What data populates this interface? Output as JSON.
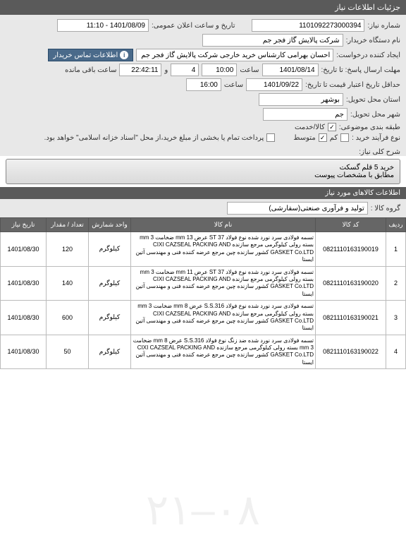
{
  "header": {
    "title": "جزئیات اطلاعات نیاز"
  },
  "form": {
    "reqno_lbl": "شماره نیاز:",
    "reqno": "1101092273000394",
    "pubdate_lbl": "تاریخ و ساعت اعلان عمومی:",
    "pubdate": "1401/08/09 - 11:10",
    "buyer_lbl": "نام دستگاه خریدار:",
    "buyer": "شرکت پالایش گاز فجر جم",
    "creator_lbl": "ایجاد کننده درخواست:",
    "creator": "احسان بهرامی کارشناس خرید خارجی شرکت پالایش گاز فجر جم",
    "contact_btn": "اطلاعات تماس خریدار",
    "deadline_lbl": "مهلت ارسال پاسخ: تا تاریخ:",
    "deadline_date": "1401/08/14",
    "time_lbl": "ساعت",
    "deadline_time": "10:00",
    "remain": "4",
    "remain_suffix": "و",
    "remain_time": "22:42:11",
    "remain_txt": "ساعت باقی مانده",
    "validity_lbl": "حداقل تاریخ اعتبار قیمت تا تاریخ:",
    "validity_date": "1401/09/22",
    "validity_time": "16:00",
    "province_lbl": "استان محل تحویل:",
    "province": "بوشهر",
    "city_lbl": "شهر محل تحویل:",
    "city": "جم",
    "service_lbl": "طبقه بندی موضوعی:",
    "service_opt": "کالا/خدمت",
    "process_lbl": "نوع فرآیند خرید :",
    "process_low": "کم",
    "process_mid": "متوسط",
    "process_note": "پرداخت تمام یا بخشی از مبلغ خرید،از محل \"اسناد خزانه اسلامی\" خواهد بود."
  },
  "desc": {
    "title_lbl": "شرح کلی نیاز:",
    "line1": "خرید 5 قلم گسکت",
    "line2": "مطابق با مشخصات پیوست"
  },
  "items_section": "اطلاعات کالاهای مورد نیاز",
  "group_lbl": "گروه کالا :",
  "group_val": "تولید و فرآوری صنعتی(سفارشی)",
  "columns": {
    "row": "ردیف",
    "code": "کد کالا",
    "name": "نام کالا",
    "unit": "واحد شمارش",
    "qty": "تعداد / مقدار",
    "date": "تاریخ نیاز"
  },
  "rows": [
    {
      "n": "1",
      "code": "0821110163190019",
      "name": "تسمه فولادی سرد نورد شده نوع فولاد ST 37 عرض 13 mm ضخامت 3 mm بسته رولی کیلوگرمی مرجع سازنده CIXI CAZSEAL PACKING AND GASKET Co.LTD کشور سازنده چین مرجع عرضه کننده فنی و مهندسی آتین ایستا",
      "unit": "کیلوگرم",
      "qty": "120",
      "date": "1401/08/30"
    },
    {
      "n": "2",
      "code": "0821110163190020",
      "name": "تسمه فولادی سرد نورد شده نوع فولاد ST 37 عرض 11 mm ضخامت 3 mm بسته رولی کیلوگرمی مرجع سازنده CIXI CAZSEAL PACKING AND GASKET Co.LTD کشور سازنده چین مرجع عرضه کننده فنی و مهندسی آتین ایستا",
      "unit": "کیلوگرم",
      "qty": "140",
      "date": "1401/08/30"
    },
    {
      "n": "3",
      "code": "0821110163190021",
      "name": "تسمه فولادی سرد نورد شده نوع فولاد S.S.316 عرض 8 mm ضخامت 3 mm بسته رولی کیلوگرمی مرجع سازنده CIXI CAZSEAL PACKING AND GASKET Co.LTD کشور سازنده چین مرجع عرضه کننده فنی و مهندسی آتین ایستا",
      "unit": "کیلوگرم",
      "qty": "600",
      "date": "1401/08/30"
    },
    {
      "n": "4",
      "code": "0821110163190022",
      "name": "تسمه فولادی سرد نورد شده ضد زنگ نوع فولاد S.S.316 عرض 8 mm ضخامت 3 mm بسته رولی کیلوگرمی مرجع سازنده CIXI CAZSEAL PACKING AND GASKET Co.LTD کشور سازنده چین مرجع عرضه کننده فنی و مهندسی آتین ایستا",
      "unit": "کیلوگرم",
      "qty": "50",
      "date": "1401/08/30"
    }
  ]
}
